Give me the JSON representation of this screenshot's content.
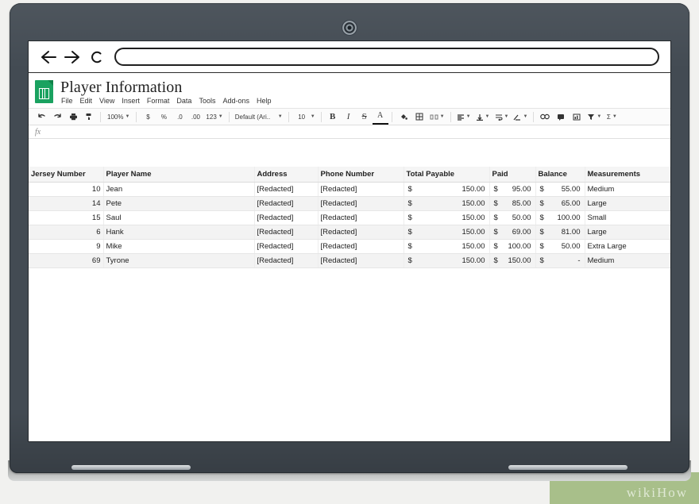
{
  "browser": {
    "back_icon": "arrow-left-icon",
    "forward_icon": "arrow-right-icon",
    "reload_icon": "reload-icon",
    "address_value": "",
    "address_placeholder": ""
  },
  "app": {
    "logo": "google-sheets-icon",
    "doc_title": "Player Information",
    "menu": [
      "File",
      "Edit",
      "View",
      "Insert",
      "Format",
      "Data",
      "Tools",
      "Add-ons",
      "Help"
    ]
  },
  "toolbar": {
    "undo": "undo-icon",
    "redo": "redo-icon",
    "print": "print-icon",
    "paint_format": "paint-format-icon",
    "zoom_value": "100%",
    "currency": "$",
    "percent": "%",
    "decrease_decimal": ".0",
    "increase_decimal": ".00",
    "more_formats": "123",
    "font_name": "Default (Ari..",
    "font_size": "10",
    "bold": "B",
    "italic": "I",
    "strikethrough": "S",
    "text_color": "A",
    "fill_color": "fill-color-icon",
    "borders": "borders-icon",
    "merge_cells": "merge-cells-icon",
    "horizontal_align": "horizontal-align-icon",
    "vertical_align": "vertical-align-icon",
    "text_wrap": "text-wrap-icon",
    "text_rotation": "text-rotation-icon",
    "insert_link": "link-icon",
    "insert_comment": "comment-icon",
    "insert_chart": "chart-icon",
    "filter": "filter-icon",
    "functions": "Σ"
  },
  "formula_bar": {
    "fx_label": "fx",
    "value": ""
  },
  "sheet": {
    "columns": [
      "Jersey Number",
      "Player Name",
      "Address",
      "Phone Number",
      "Total Payable",
      "Paid",
      "Balance",
      "Measurements"
    ],
    "rows": [
      {
        "jersey": "10",
        "name": "Jean",
        "address": "[Redacted]",
        "phone": "[Redacted]",
        "total_sym": "$",
        "total_amt": "150.00",
        "paid_sym": "$",
        "paid_amt": "95.00",
        "balance_sym": "$",
        "balance_amt": "55.00",
        "measurements": "Medium"
      },
      {
        "jersey": "14",
        "name": "Pete",
        "address": "[Redacted]",
        "phone": "[Redacted]",
        "total_sym": "$",
        "total_amt": "150.00",
        "paid_sym": "$",
        "paid_amt": "85.00",
        "balance_sym": "$",
        "balance_amt": "65.00",
        "measurements": "Large"
      },
      {
        "jersey": "15",
        "name": "Saul",
        "address": "[Redacted]",
        "phone": "[Redacted]",
        "total_sym": "$",
        "total_amt": "150.00",
        "paid_sym": "$",
        "paid_amt": "50.00",
        "balance_sym": "$",
        "balance_amt": "100.00",
        "measurements": "Small"
      },
      {
        "jersey": "6",
        "name": "Hank",
        "address": "[Redacted]",
        "phone": "[Redacted]",
        "total_sym": "$",
        "total_amt": "150.00",
        "paid_sym": "$",
        "paid_amt": "69.00",
        "balance_sym": "$",
        "balance_amt": "81.00",
        "measurements": "Large"
      },
      {
        "jersey": "9",
        "name": "Mike",
        "address": "[Redacted]",
        "phone": "[Redacted]",
        "total_sym": "$",
        "total_amt": "150.00",
        "paid_sym": "$",
        "paid_amt": "100.00",
        "balance_sym": "$",
        "balance_amt": "50.00",
        "measurements": "Extra Large"
      },
      {
        "jersey": "69",
        "name": "Tyrone",
        "address": "[Redacted]",
        "phone": "[Redacted]",
        "total_sym": "$",
        "total_amt": "150.00",
        "paid_sym": "$",
        "paid_amt": "150.00",
        "balance_sym": "$",
        "balance_amt": "-",
        "measurements": "Medium"
      }
    ]
  },
  "watermark": {
    "text": "wikiHow"
  }
}
